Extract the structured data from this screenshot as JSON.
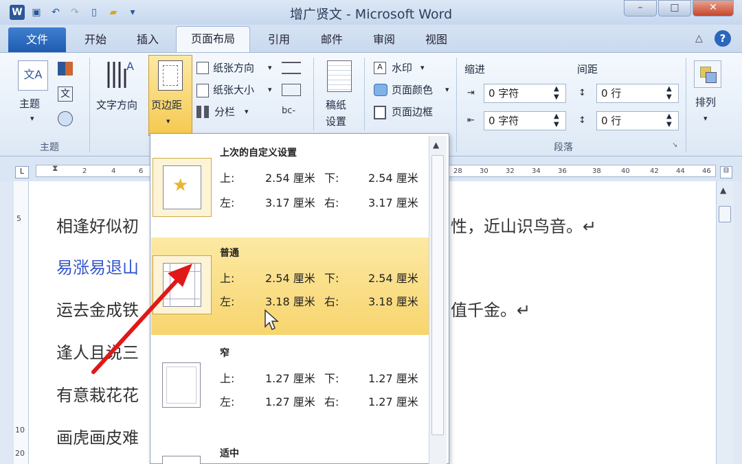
{
  "window": {
    "title": "增广贤文 - Microsoft Word",
    "minimize": "–",
    "maximize": "□",
    "close": "✕"
  },
  "tabs": [
    "文件",
    "开始",
    "插入",
    "页面布局",
    "引用",
    "邮件",
    "审阅",
    "视图"
  ],
  "ribbon": {
    "theme": {
      "btn": "主题",
      "group": "主题"
    },
    "text_direction": "文字方向",
    "margins": "页边距",
    "orientation": "纸张方向",
    "size": "纸张大小",
    "columns": "分栏",
    "page_setup": {
      "line1": "稿纸",
      "line2": "设置"
    },
    "watermark": "水印",
    "page_color": "页面颜色",
    "page_border": "页面边框",
    "indent": {
      "label": "缩进",
      "left": "0 字符",
      "right": "0 字符"
    },
    "spacing": {
      "label": "间距",
      "before": "0 行",
      "after": "0 行"
    },
    "paragraph_group": "段落",
    "arrange": "排列"
  },
  "ruler_numbers": [
    "2",
    "4",
    "6",
    "28",
    "30",
    "32",
    "34",
    "36",
    "38",
    "40",
    "42",
    "44",
    "46"
  ],
  "left_ruler": [
    "5",
    "10",
    "20"
  ],
  "document": {
    "lines": [
      {
        "text": "相逢好似初",
        "tail": "性，近山识鸟音。↵"
      },
      {
        "text": "易涨易退山",
        "tail": ""
      },
      {
        "text": "运去金成铁",
        "tail": "值千金。↵"
      },
      {
        "text": "逢人且说三",
        "tail": ""
      },
      {
        "text": "有意栽花花",
        "tail": ""
      },
      {
        "text": "画虎画皮难",
        "tail": ""
      }
    ]
  },
  "margins_menu": {
    "options": [
      {
        "name": "上次的自定义设置",
        "top_label": "上:",
        "top": "2.54 厘米",
        "bottom_label": "下:",
        "bottom": "2.54 厘米",
        "left_label": "左:",
        "left": "3.17 厘米",
        "right_label": "右:",
        "right": "3.17 厘米"
      },
      {
        "name": "普通",
        "top_label": "上:",
        "top": "2.54 厘米",
        "bottom_label": "下:",
        "bottom": "2.54 厘米",
        "left_label": "左:",
        "left": "3.18 厘米",
        "right_label": "右:",
        "right": "3.18 厘米"
      },
      {
        "name": "窄",
        "top_label": "上:",
        "top": "1.27 厘米",
        "bottom_label": "下:",
        "bottom": "1.27 厘米",
        "left_label": "左:",
        "left": "1.27 厘米",
        "right_label": "右:",
        "right": "1.27 厘米"
      },
      {
        "name": "适中"
      }
    ]
  },
  "colors": {
    "highlight": "#f7d56e",
    "file_tab": "#2b66bd",
    "arrow": "#e01818"
  }
}
